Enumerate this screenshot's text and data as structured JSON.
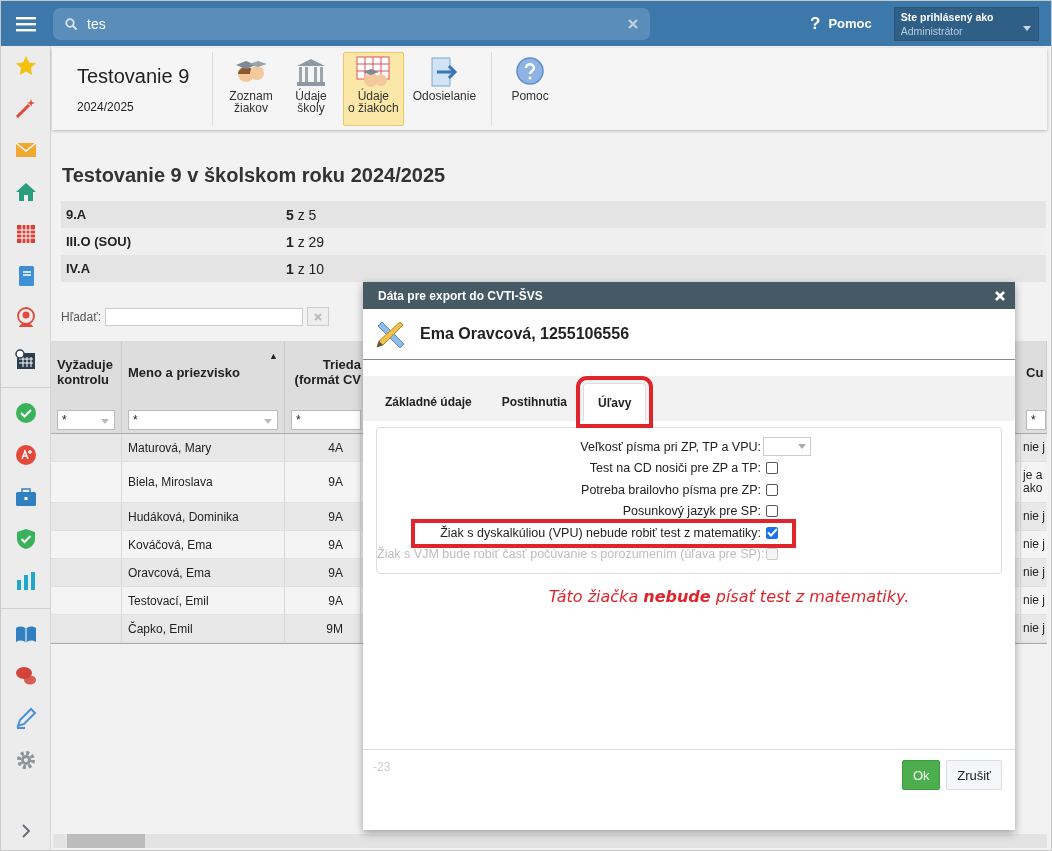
{
  "top_bar": {
    "search": {
      "value": "tes"
    },
    "help_icon": "?",
    "help_label": "Pomoc",
    "user": {
      "caption": "Ste prihlásený ako",
      "name": "Administrátor"
    }
  },
  "app_header": {
    "title": "Testovanie 9",
    "year": "2024/2025"
  },
  "toolbar": [
    {
      "label": "Zoznam\nžiakov",
      "kind": "students",
      "selected": false
    },
    {
      "label": "Údaje\nškoly",
      "kind": "school",
      "selected": false
    },
    {
      "label": "Údaje\no žiakoch",
      "kind": "student-data",
      "selected": true
    },
    {
      "label": "Odosielanie",
      "kind": "send",
      "selected": false
    },
    {
      "label": "Pomoc",
      "kind": "help",
      "selected": false
    }
  ],
  "page_title": "Testovanie 9 v školskom roku 2024/2025",
  "classes": [
    {
      "name": "9.A",
      "count": "**5** z 5"
    },
    {
      "name": "III.O (SOU)",
      "count": "**1** z 29"
    },
    {
      "name": "IV.A",
      "count": "**1** z 10"
    }
  ],
  "search": {
    "label": "Hľadať:"
  },
  "table": {
    "columns": [
      {
        "label": "Vyžaduje kontrolu",
        "filter": "*",
        "kind": "select"
      },
      {
        "label": "Meno a priezvisko",
        "sort_indicator": "▲",
        "filter": "*",
        "kind": "select"
      },
      {
        "label": "Trieda (formát CV",
        "filter": "*",
        "kind": "text"
      },
      {
        "label": "Cu",
        "filter": "*",
        "kind": "text"
      }
    ],
    "rows": [
      {
        "name": "Maturová, Mary",
        "class": "4A",
        "column_4": "nie j"
      },
      {
        "name": "Biela, Miroslava",
        "class": "9A",
        "column_4": "je a\nako"
      },
      {
        "name": "Hudáková, Dominika",
        "class": "9A",
        "column_4": "nie j"
      },
      {
        "name": "Kováčová, Ema",
        "class": "9A",
        "column_4": "nie j"
      },
      {
        "name": "Oravcová, Ema",
        "class": "9A",
        "column_4": "nie j"
      },
      {
        "name": "Testovací, Emil",
        "class": "9A",
        "column_4": "nie j"
      },
      {
        "name": "Čapko, Emil",
        "class": "9M",
        "column_4": "nie j"
      }
    ]
  },
  "dialog": {
    "title": "Dáta pre export do CVTI-ŠVS",
    "heading": "Ema Oravcová, 1255106556",
    "tabs": [
      {
        "label": "Základné údaje",
        "selected": false,
        "highlighted": false
      },
      {
        "label": "Postihnutia",
        "selected": false,
        "highlighted": false
      },
      {
        "label": "Úľavy",
        "selected": true,
        "highlighted": true
      }
    ],
    "fields": [
      {
        "kind": "select",
        "label": "Veľkosť písma pri ZP, TP a VPU:",
        "disabled": false,
        "highlighted": false
      },
      {
        "kind": "checkbox",
        "label": "Test na CD nosiči pre ZP a TP:",
        "checked": false,
        "disabled": false,
        "highlighted": false
      },
      {
        "kind": "checkbox",
        "label": "Potreba brailovho písma pre ZP:",
        "checked": false,
        "disabled": false,
        "highlighted": false
      },
      {
        "kind": "checkbox",
        "label": "Posunkový jazyk pre SP:",
        "checked": false,
        "disabled": false,
        "highlighted": false
      },
      {
        "kind": "checkbox",
        "label": "Žiak s dyskalkúliou (VPU) nebude robiť test z matematiky:",
        "checked": true,
        "disabled": false,
        "highlighted": true
      },
      {
        "kind": "checkbox",
        "label": "Žiak s VJM bude robiť časť počúvanie s porozumením (úľava pre SP):",
        "checked": false,
        "disabled": true,
        "highlighted": false
      }
    ],
    "annotation": "Táto žiačka **nebude** písať test z matematiky.",
    "footer_note": "-23",
    "buttons": [
      {
        "label": "Ok",
        "kind": "primary"
      },
      {
        "label": "Zrušiť",
        "kind": "default"
      }
    ]
  }
}
